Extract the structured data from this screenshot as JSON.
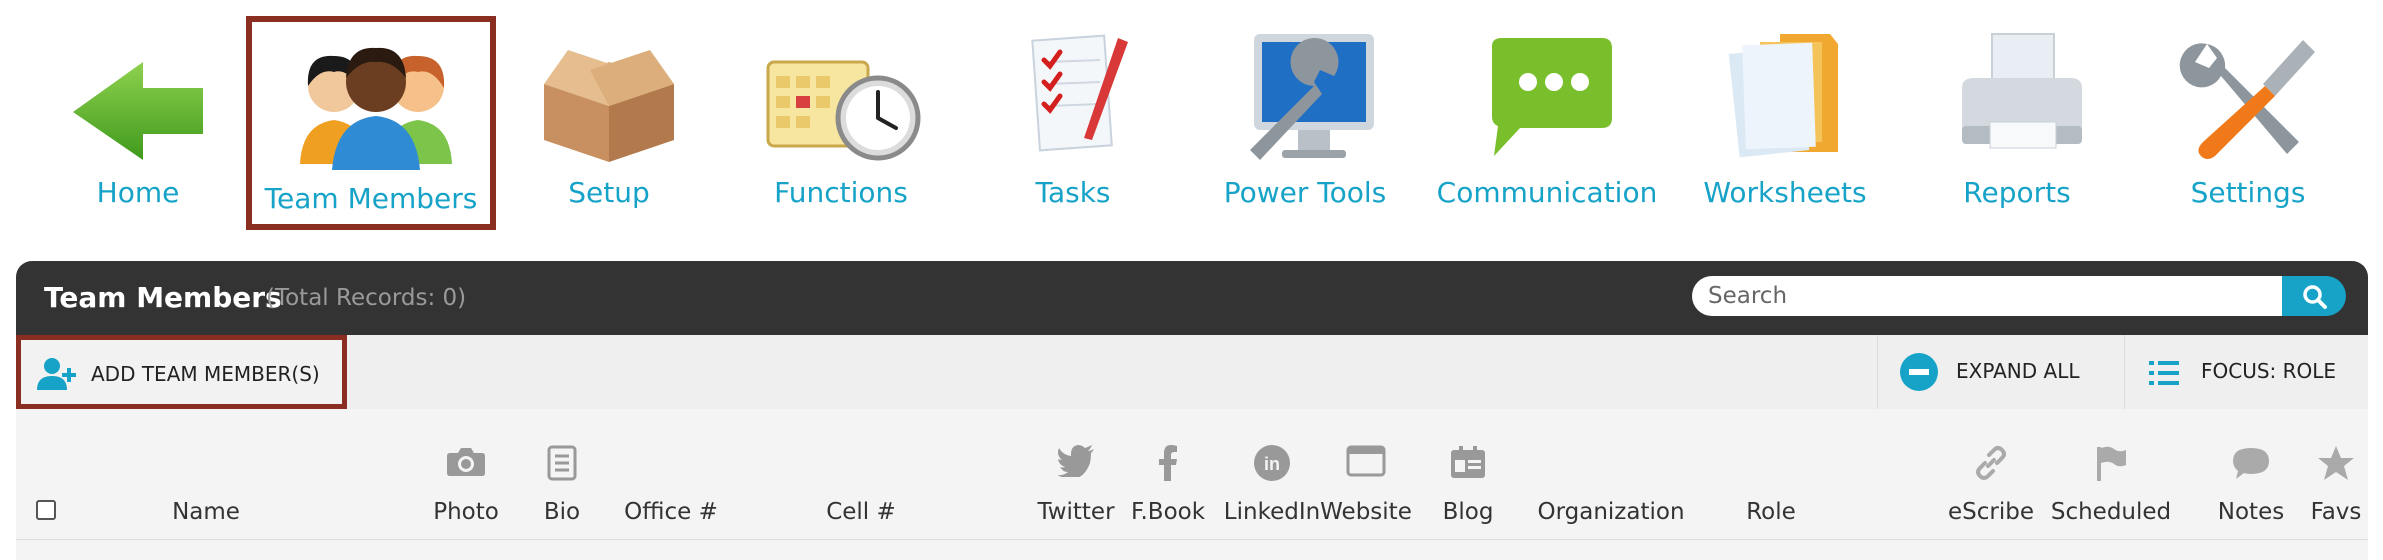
{
  "nav": {
    "items": [
      {
        "label": "Home",
        "icon": "home-arrow-icon"
      },
      {
        "label": "Team Members",
        "icon": "team-members-icon",
        "active": true
      },
      {
        "label": "Setup",
        "icon": "box-icon"
      },
      {
        "label": "Functions",
        "icon": "calendar-clock-icon"
      },
      {
        "label": "Tasks",
        "icon": "checklist-icon"
      },
      {
        "label": "Power Tools",
        "icon": "monitor-wrench-icon"
      },
      {
        "label": "Communication",
        "icon": "chat-bubble-icon"
      },
      {
        "label": "Worksheets",
        "icon": "folder-docs-icon"
      },
      {
        "label": "Reports",
        "icon": "printer-icon"
      },
      {
        "label": "Settings",
        "icon": "tools-icon"
      }
    ]
  },
  "panel": {
    "title": "Team Members",
    "total_records": "(Total Records: 0)",
    "search_placeholder": "Search"
  },
  "toolbar": {
    "add_label": "ADD TEAM MEMBER(S)",
    "expand_label": "EXPAND ALL",
    "focus_label": "FOCUS: ROLE"
  },
  "columns": {
    "name": "Name",
    "photo": "Photo",
    "bio": "Bio",
    "office": "Office #",
    "cell": "Cell #",
    "twitter": "Twitter",
    "fbook": "F.Book",
    "linkedin": "LinkedIn",
    "website": "Website",
    "blog": "Blog",
    "organization": "Organization",
    "role": "Role",
    "escribe": "eScribe",
    "scheduled": "Scheduled",
    "notes": "Notes",
    "favs": "Favs"
  },
  "colors": {
    "accent": "#17a3c8",
    "header_bg": "#333333",
    "highlight_border": "#8b2e22",
    "toolbar_bg": "#efefef"
  }
}
